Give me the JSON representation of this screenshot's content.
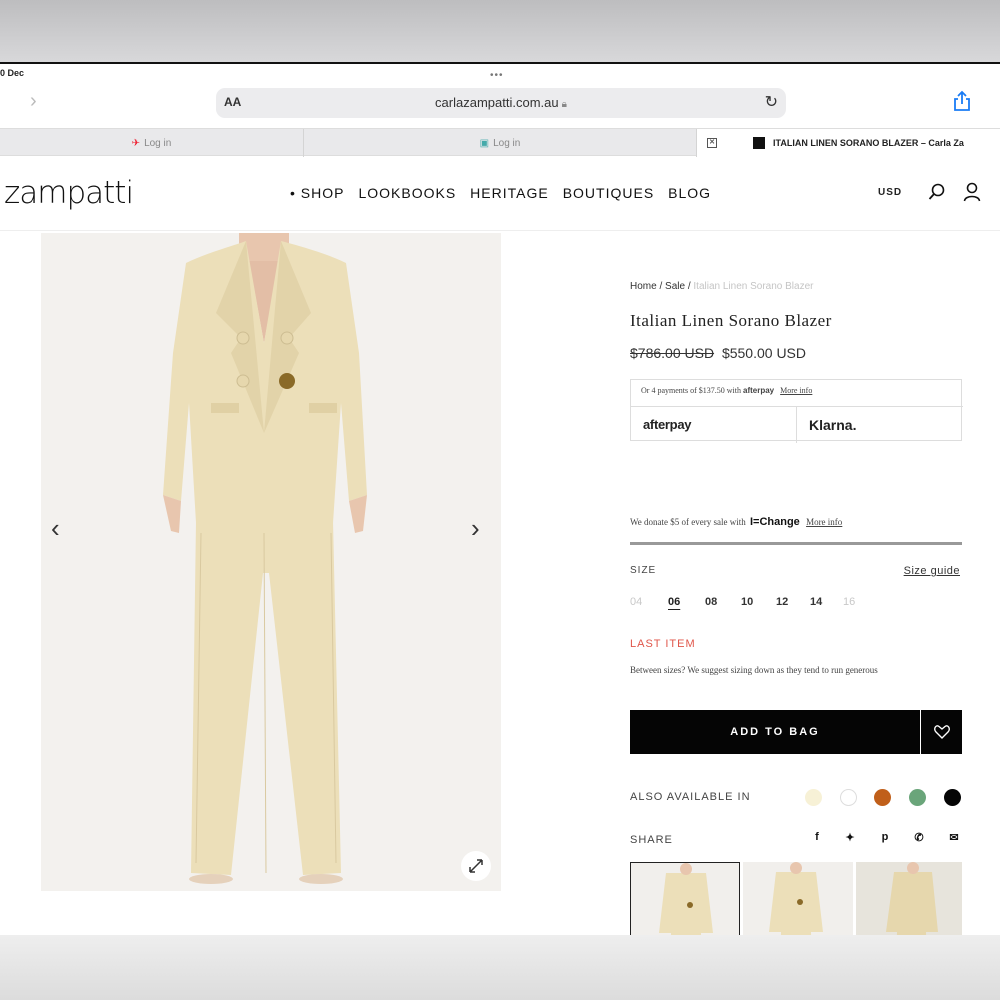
{
  "browser": {
    "status_time": "0 Dec",
    "text_size_label": "AA",
    "url": "carlazampatti.com.au",
    "tabs": [
      {
        "label": "Log in"
      },
      {
        "label": "Log in"
      },
      {
        "label": "ITALIAN LINEN SORANO BLAZER – Carla Za"
      }
    ]
  },
  "site": {
    "logo": "zampatti",
    "nav": [
      "• SHOP",
      "LOOKBOOKS",
      "HERITAGE",
      "BOUTIQUES",
      "BLOG"
    ],
    "currency": "USD"
  },
  "product": {
    "breadcrumb": {
      "home": "Home",
      "sep": "/",
      "sale": "Sale",
      "current": "Italian Linen Sorano Blazer"
    },
    "title": "Italian Linen Sorano Blazer",
    "old_price": "$786.00 USD",
    "price": "$550.00 USD",
    "installments_text": "Or 4 payments of $137.50 with",
    "installments_brand": "afterpay",
    "more_info": "More info",
    "afterpay_label": "afterpay",
    "klarna_label": "Klarna.",
    "donate_text": "We donate $5 of every sale with",
    "donate_brand": "I=Change",
    "donate_more": "More info",
    "size_label": "SIZE",
    "size_guide": "Size guide",
    "sizes": [
      "04",
      "06",
      "08",
      "10",
      "12",
      "14",
      "16"
    ],
    "stock_note": "LAST ITEM",
    "sizing_note": "Between sizes? We suggest sizing down as they tend to run generous",
    "add_to_bag": "ADD TO BAG",
    "also_available": "ALSO AVAILABLE IN",
    "swatch_colors": [
      "#f7f1d6",
      "#ffffff",
      "#c05f1a",
      "#6aa57a",
      "#050505"
    ],
    "share_label": "SHARE"
  },
  "colors": {
    "suit": "#ecdfb9",
    "suit_shadow": "#d9c9a0",
    "accent_red": "#e0564a"
  }
}
